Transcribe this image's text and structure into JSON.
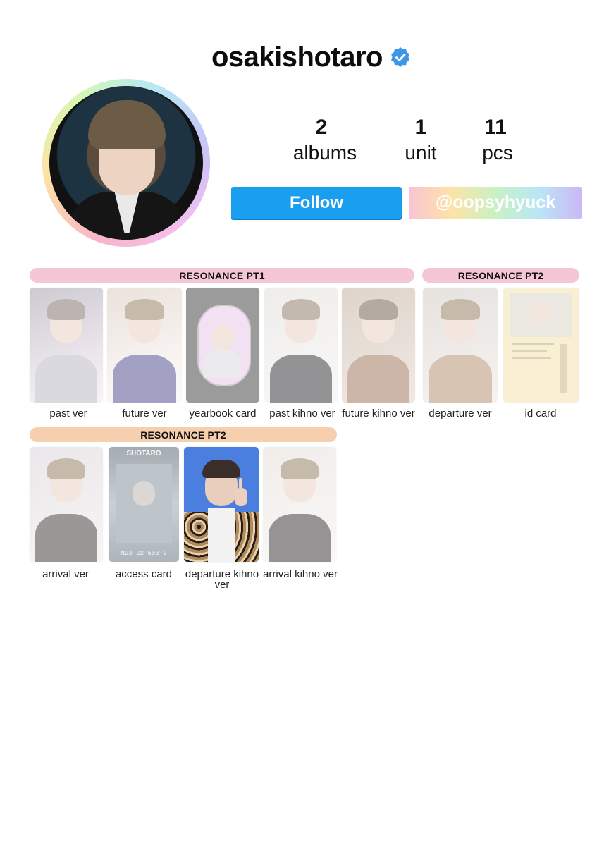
{
  "profile": {
    "username": "osakishotaro",
    "verified_icon": "verified-badge-icon",
    "avatar_icon": "profile-photo",
    "ring_colors": [
      "#f7b6c9",
      "#fde2a5",
      "#d9f7b0",
      "#b6e9f5",
      "#c9c3f7"
    ]
  },
  "stats": [
    {
      "value": "2",
      "label": "albums"
    },
    {
      "value": "1",
      "label": "unit"
    },
    {
      "value": "11",
      "label": "pcs"
    }
  ],
  "buttons": {
    "follow_label": "Follow",
    "follow_color": "#1a9ef0",
    "handle_label": "@oopsyhyuck"
  },
  "sections": [
    {
      "title": "RESONANCE PT1",
      "color": "#f5c7d6",
      "cards": [
        {
          "caption": "past ver"
        },
        {
          "caption": "future ver"
        },
        {
          "caption": "yearbook card"
        },
        {
          "caption": "past kihno ver"
        },
        {
          "caption": "future kihno ver"
        }
      ]
    },
    {
      "title": "RESONANCE PT2",
      "color": "#f5c7d6",
      "cards": [
        {
          "caption": "departure ver"
        },
        {
          "caption": "id card"
        }
      ]
    },
    {
      "title": "RESONANCE PT2",
      "color": "#f6cfae",
      "cards": [
        {
          "caption": "arrival ver"
        },
        {
          "caption": "access card",
          "card_text_top": "SHOTARO",
          "card_text_bottom": "N23-22-503-V"
        },
        {
          "caption": "departure kihno ver",
          "owned": true
        },
        {
          "caption": "arrival kihno ver"
        }
      ]
    }
  ]
}
